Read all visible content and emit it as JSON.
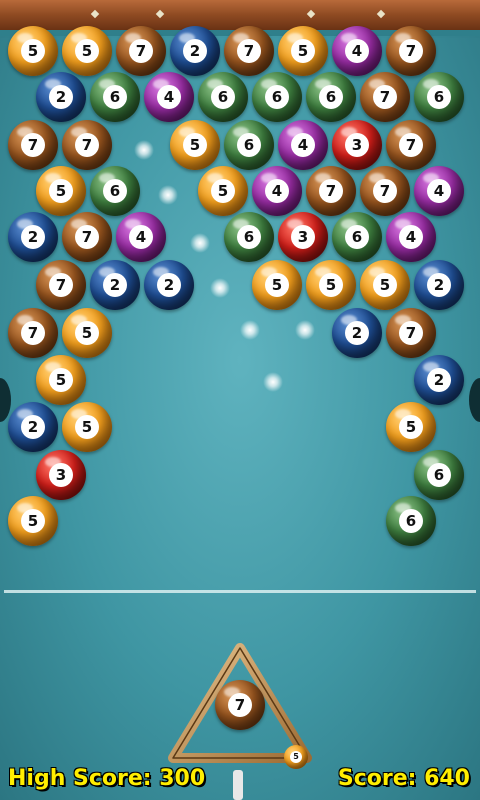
{
  "hud": {
    "high_score_label": "High Score: 300",
    "score_label": "Score: 640"
  },
  "colors": {
    "orange": "#f7a21e",
    "brown": "#9a561f",
    "blue": "#1f4f96",
    "purple": "#9a2da5",
    "green": "#3f8040",
    "red": "#d41f1a",
    "table_felt": "#4aa3b0",
    "score_text": "#ffee00"
  },
  "balls": [
    {
      "color": "orange",
      "n": "5"
    },
    {
      "color": "orange",
      "n": "5"
    },
    {
      "color": "brown",
      "n": "7"
    },
    {
      "color": "blue",
      "n": "2"
    },
    {
      "color": "brown",
      "n": "7"
    },
    {
      "color": "orange",
      "n": "5"
    },
    {
      "color": "purple",
      "n": "4"
    },
    {
      "color": "brown",
      "n": "7"
    },
    {
      "color": "blue",
      "n": "2"
    },
    {
      "color": "green",
      "n": "6"
    },
    {
      "color": "purple",
      "n": "4"
    },
    {
      "color": "green",
      "n": "6"
    },
    {
      "color": "green",
      "n": "6"
    },
    {
      "color": "green",
      "n": "6"
    },
    {
      "color": "brown",
      "n": "7"
    },
    {
      "color": "green",
      "n": "6"
    },
    {
      "color": "brown",
      "n": "7"
    },
    {
      "color": "brown",
      "n": "7"
    },
    {
      "color": "orange",
      "n": "5"
    },
    {
      "color": "green",
      "n": "6"
    },
    {
      "color": "purple",
      "n": "4"
    },
    {
      "color": "red",
      "n": "3"
    },
    {
      "color": "brown",
      "n": "7"
    },
    {
      "color": "orange",
      "n": "5"
    },
    {
      "color": "green",
      "n": "6"
    },
    {
      "color": "orange",
      "n": "5"
    },
    {
      "color": "purple",
      "n": "4"
    },
    {
      "color": "brown",
      "n": "7"
    },
    {
      "color": "brown",
      "n": "7"
    },
    {
      "color": "purple",
      "n": "4"
    },
    {
      "color": "blue",
      "n": "2"
    },
    {
      "color": "brown",
      "n": "7"
    },
    {
      "color": "purple",
      "n": "4"
    },
    {
      "color": "green",
      "n": "6"
    },
    {
      "color": "red",
      "n": "3"
    },
    {
      "color": "green",
      "n": "6"
    },
    {
      "color": "purple",
      "n": "4"
    },
    {
      "color": "brown",
      "n": "7"
    },
    {
      "color": "blue",
      "n": "2"
    },
    {
      "color": "blue",
      "n": "2"
    },
    {
      "color": "orange",
      "n": "5"
    },
    {
      "color": "orange",
      "n": "5"
    },
    {
      "color": "orange",
      "n": "5"
    },
    {
      "color": "blue",
      "n": "2"
    },
    {
      "color": "brown",
      "n": "7"
    },
    {
      "color": "orange",
      "n": "5"
    },
    {
      "color": "blue",
      "n": "2"
    },
    {
      "color": "brown",
      "n": "7"
    },
    {
      "color": "orange",
      "n": "5"
    },
    {
      "color": "blue",
      "n": "2"
    },
    {
      "color": "blue",
      "n": "2"
    },
    {
      "color": "orange",
      "n": "5"
    },
    {
      "color": "orange",
      "n": "5"
    },
    {
      "color": "red",
      "n": "3"
    },
    {
      "color": "green",
      "n": "6"
    },
    {
      "color": "orange",
      "n": "5"
    },
    {
      "color": "green",
      "n": "6"
    }
  ],
  "launcher": {
    "current_ball": {
      "color": "brown",
      "n": "7"
    },
    "next_ball": {
      "color": "orange",
      "n": "5"
    }
  }
}
